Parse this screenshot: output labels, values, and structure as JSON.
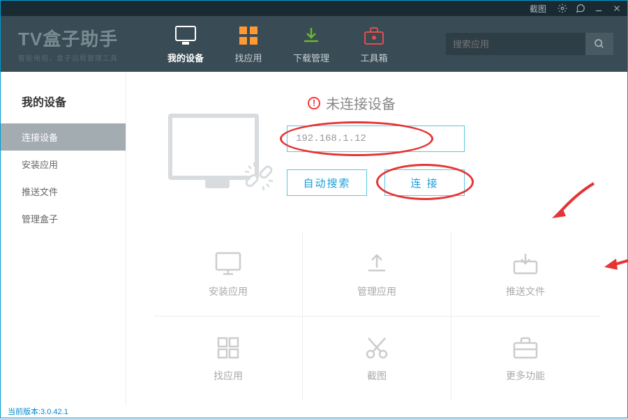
{
  "titlebar": {
    "screenshot": "截图"
  },
  "logo": {
    "title": "TV盒子助手",
    "subtitle": "智能电视，盒子远程管理工具"
  },
  "nav": {
    "devices": "我的设备",
    "apps": "找应用",
    "downloads": "下载管理",
    "toolbox": "工具箱"
  },
  "search": {
    "placeholder": "搜索应用"
  },
  "sidebar": {
    "title": "我的设备",
    "items": [
      "连接设备",
      "安装应用",
      "推送文件",
      "管理盒子"
    ]
  },
  "connect": {
    "status": "未连接设备",
    "ip": "192.168.1.12",
    "auto_search": "自动搜索",
    "connect_btn": "连 接"
  },
  "tiles": {
    "install": "安装应用",
    "manage": "管理应用",
    "push": "推送文件",
    "find": "找应用",
    "screenshot": "截图",
    "more": "更多功能"
  },
  "footer": {
    "version": "当前版本:3.0.42.1"
  }
}
